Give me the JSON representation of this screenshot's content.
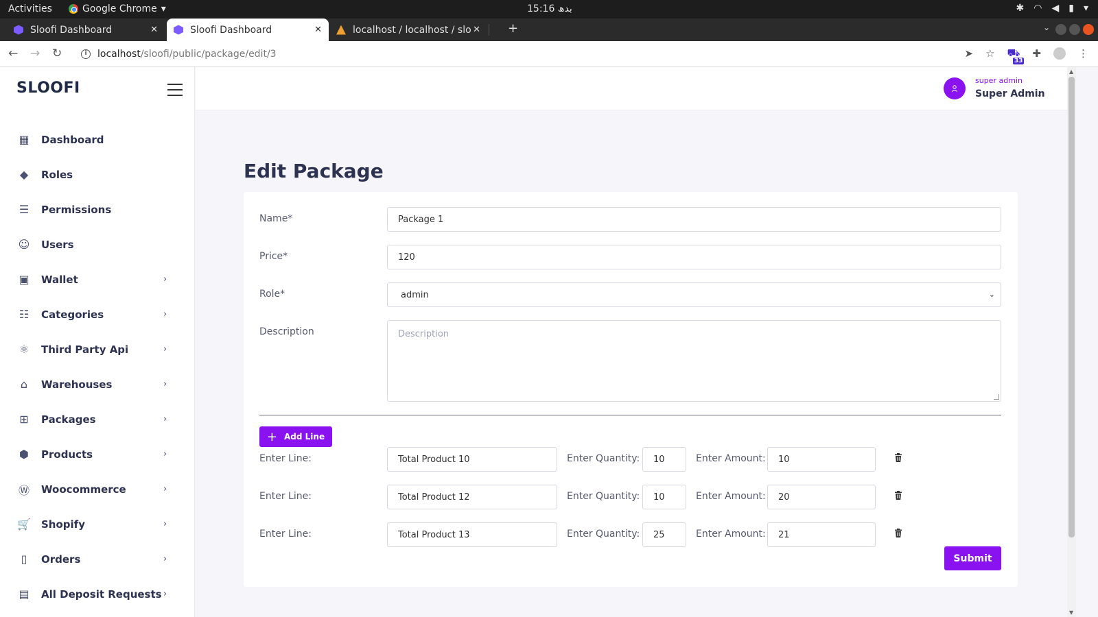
{
  "os": {
    "activities": "Activities",
    "app_name": "Google Chrome",
    "clock": "بدھ 15:16"
  },
  "browser": {
    "tabs": [
      {
        "title": "Sloofi Dashboard"
      },
      {
        "title": "Sloofi Dashboard"
      },
      {
        "title": "localhost / localhost / slo"
      }
    ],
    "url_host": "localhost",
    "url_path": "/sloofi/public/package/edit/3",
    "extension_badge": "33"
  },
  "sidebar": {
    "brand": "SLOOFI",
    "items": [
      {
        "label": "Dashboard",
        "icon": "dashboard-icon",
        "chevron": false
      },
      {
        "label": "Roles",
        "icon": "tag-icon",
        "chevron": false
      },
      {
        "label": "Permissions",
        "icon": "permissions-icon",
        "chevron": false
      },
      {
        "label": "Users",
        "icon": "users-icon",
        "chevron": false
      },
      {
        "label": "Wallet",
        "icon": "wallet-icon",
        "chevron": true
      },
      {
        "label": "Categories",
        "icon": "categories-icon",
        "chevron": true
      },
      {
        "label": "Third Party Api",
        "icon": "atom-icon",
        "chevron": true
      },
      {
        "label": "Warehouses",
        "icon": "warehouse-icon",
        "chevron": true
      },
      {
        "label": "Packages",
        "icon": "packages-icon",
        "chevron": true
      },
      {
        "label": "Products",
        "icon": "box-icon",
        "chevron": true
      },
      {
        "label": "Woocommerce",
        "icon": "wordpress-icon",
        "chevron": true
      },
      {
        "label": "Shopify",
        "icon": "cart-icon",
        "chevron": true
      },
      {
        "label": "Orders",
        "icon": "orders-icon",
        "chevron": true
      },
      {
        "label": "All Deposit Requests",
        "icon": "deposit-icon",
        "chevron": true
      }
    ]
  },
  "header": {
    "user_role": "super admin",
    "user_name": "Super Admin"
  },
  "main": {
    "title": "Edit Package",
    "fields": {
      "name_label": "Name*",
      "name_value": "Package 1",
      "price_label": "Price*",
      "price_value": "120",
      "role_label": "Role*",
      "role_value": "admin",
      "description_label": "Description",
      "description_placeholder": "Description"
    },
    "add_line_label": "Add Line",
    "line_label": "Enter Line:",
    "quantity_label": "Enter Quantity:",
    "amount_label": "Enter Amount:",
    "lines": [
      {
        "line": "Total Product 10",
        "quantity": "10",
        "amount": "10"
      },
      {
        "line": "Total Product 12",
        "quantity": "10",
        "amount": "20"
      },
      {
        "line": "Total Product 13",
        "quantity": "25",
        "amount": "21"
      }
    ],
    "submit_label": "Submit"
  },
  "colors": {
    "accent": "#8a12f0",
    "sidebar_text": "#2d3250",
    "background": "#f6f6fa"
  }
}
